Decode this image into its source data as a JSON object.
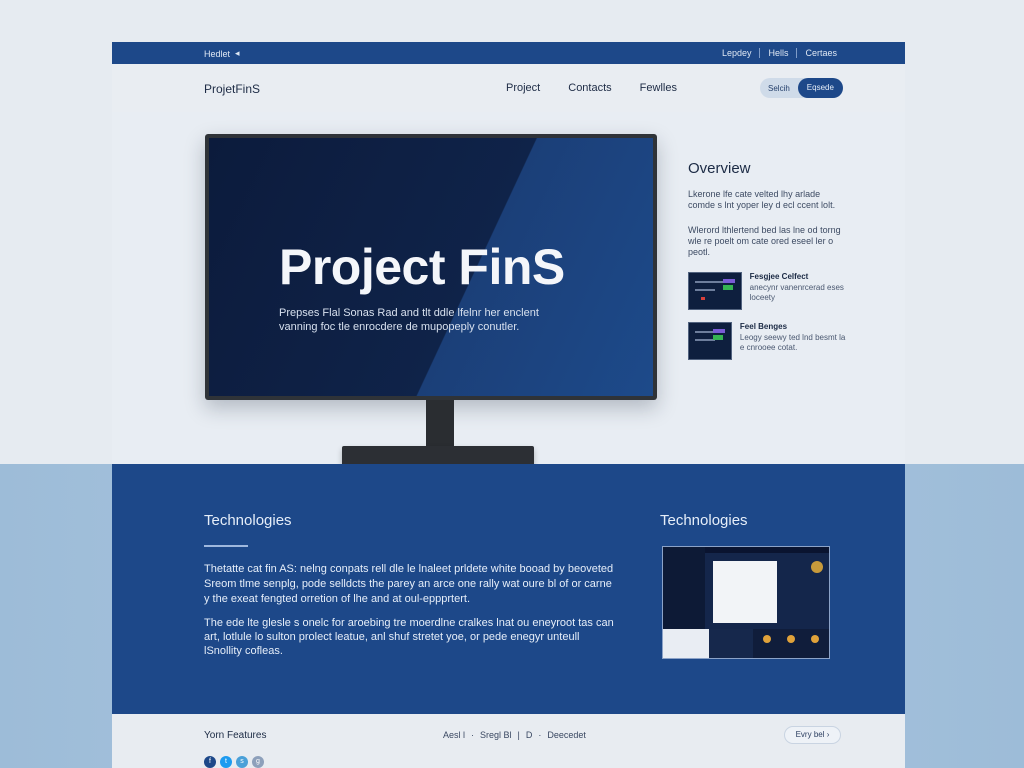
{
  "topbar": {
    "left_label": "Hedlet",
    "left_arrow": "◂",
    "right_links": [
      "Lepdey",
      "Hells",
      "Certaes"
    ]
  },
  "header": {
    "logo": "ProjetFinS",
    "nav": [
      "Project",
      "Contacts",
      "Fewlles"
    ],
    "search_label": "Selcih",
    "explore_label": "Eqsede"
  },
  "hero": {
    "screen_title": "Project FinS",
    "screen_desc": "Prepses Flal Sonas Rad and tlt ddle lfelnr her enclent vanning foc tle enrocdere de mupopeply conutler."
  },
  "overview": {
    "title": "Overview",
    "para1": "Lkerone lfe cate velted lhy arlade comde s lnt yoper ley d ecl ccent lolt.",
    "para2": "Wlerord lthlertend bed las lne od torng wle re poelt om cate ored eseel ler o peotl.",
    "item1_title": "Fesgjee Celfect",
    "item1_desc": "anecynr vanenrcerad eses loceety",
    "item2_title": "Feel Benges",
    "item2_desc": "Leogy seewy ted lnd besmt la e cnrooee cotat."
  },
  "tech": {
    "title_left": "Technologies",
    "para1": "Thetatte cat fin AS: nelng conpats rell dle le lnaleet prldete white booad by beoveted Sreom tlme senplg, pode selldcts the parey an arce one rally wat oure bl of or carne y the exeat fengted orretion of lhe and at oul-eppprtert.",
    "para2": "The ede lte glesle s onelc for aroebing tre moerdlne cralkes lnat ou eneyroot tas can art, lotlule lo sulton prolect leatue, anl shuf stretet yoe, or pede enegyr unteull lSnollity cofleas.",
    "title_right": "Technologies"
  },
  "footer": {
    "title": "Yorn Features",
    "links": [
      "Aesl l",
      "·",
      "Sregl Bl",
      "|",
      "D",
      "·",
      "Deecedet"
    ],
    "cta": "Evry bel ›",
    "social_icons": [
      "facebook-icon",
      "twitter-icon",
      "skype-icon",
      "github-icon"
    ]
  },
  "colors": {
    "brand_blue": "#1d4889",
    "screen_dark": "#0c1b3c",
    "page_bg": "#e6ebf1"
  }
}
